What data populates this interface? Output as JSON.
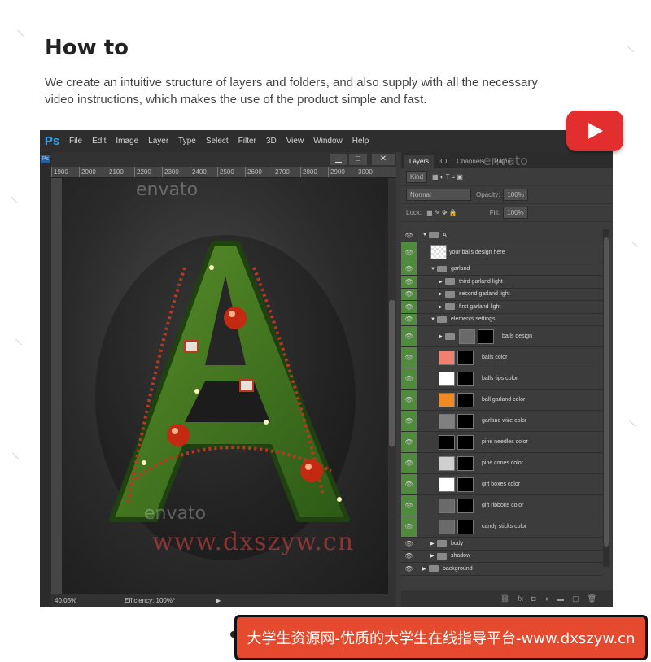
{
  "header": {
    "title": "How to",
    "description": "We create an intuitive structure of layers and folders, and also supply with all the necessary video instructions, which makes the use of the product simple and fast."
  },
  "photoshop": {
    "logo": "Ps",
    "menu": [
      "File",
      "Edit",
      "Image",
      "Layer",
      "Type",
      "Select",
      "Filter",
      "3D",
      "View",
      "Window",
      "Help"
    ],
    "doc_tab": "Ps",
    "window_buttons": [
      "▁",
      "□",
      "✕"
    ],
    "ruler_ticks": [
      "1900",
      "2000",
      "2100",
      "2200",
      "2300",
      "2400",
      "2500",
      "2600",
      "2700",
      "2800",
      "2900",
      "3000",
      "3100"
    ],
    "watermark": "envato",
    "site_watermark": "www.dxszyw.cn",
    "status_zoom": "40,05%",
    "status_text": "Efficiency: 100%*",
    "panel_tabs": [
      "Layers",
      "3D",
      "Channels",
      "Paths"
    ],
    "filter_kind": "Kind",
    "blend_mode": "Normal",
    "opacity_label": "Opacity:",
    "opacity_value": "100%",
    "lock_label": "Lock:",
    "fill_label": "Fill:",
    "fill_value": "100%",
    "layers": [
      {
        "name": "A",
        "type": "group",
        "indent": 0,
        "open": true
      },
      {
        "name": "your balls design here",
        "type": "smart",
        "indent": 1
      },
      {
        "name": "garland",
        "type": "group",
        "indent": 1,
        "open": true
      },
      {
        "name": "third garland light",
        "type": "group",
        "indent": 2
      },
      {
        "name": "second garland light",
        "type": "group",
        "indent": 2
      },
      {
        "name": "first garland light",
        "type": "group",
        "indent": 2
      },
      {
        "name": "elements settings",
        "type": "group",
        "indent": 1,
        "open": true
      },
      {
        "name": "balls design",
        "type": "group-mask",
        "indent": 2
      },
      {
        "name": "balls color",
        "type": "fill",
        "indent": 2,
        "color": "#f08070"
      },
      {
        "name": "balls tips color",
        "type": "fill",
        "indent": 2,
        "color": "#ffffff"
      },
      {
        "name": "ball garland color",
        "type": "fill",
        "indent": 2,
        "color": "#f08a22"
      },
      {
        "name": "garland wire color",
        "type": "fill",
        "indent": 2,
        "color": "#808080"
      },
      {
        "name": "pine needles color",
        "type": "fill",
        "indent": 2,
        "color": "#000000"
      },
      {
        "name": "pine cones color",
        "type": "fill",
        "indent": 2,
        "color": "#cfcfcf"
      },
      {
        "name": "gift boxes color",
        "type": "fill",
        "indent": 2,
        "color": "#ffffff"
      },
      {
        "name": "gift ribbons color",
        "type": "adjust",
        "indent": 2
      },
      {
        "name": "candy sticks color",
        "type": "adjust",
        "indent": 2
      },
      {
        "name": "body",
        "type": "group",
        "indent": 1
      },
      {
        "name": "shadow",
        "type": "group",
        "indent": 1
      },
      {
        "name": "background",
        "type": "group",
        "indent": 0
      }
    ]
  },
  "banner": {
    "text": "大学生资源网-优质的大学生在线指导平台-www.dxszyw.cn"
  },
  "colors": {
    "youtube_red": "#e22e2e",
    "banner_orange": "#e64a2e",
    "layer_eye_active": "#4f8a3d",
    "ps_blue": "#2fa3f3"
  }
}
